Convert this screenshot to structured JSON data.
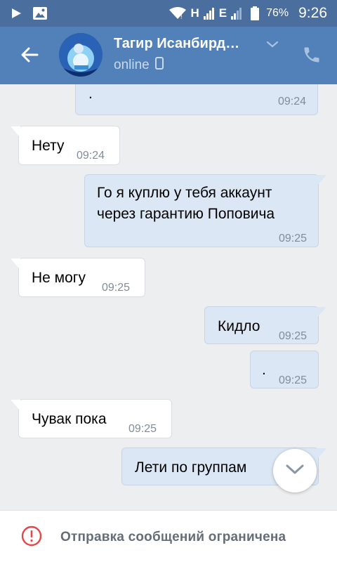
{
  "status_bar": {
    "network_label_1": "H",
    "network_label_2": "E",
    "battery_percent": "76%",
    "time": "9:26",
    "icons": [
      "play-icon",
      "image-icon",
      "wifi-icon",
      "signal-icon",
      "battery-icon"
    ]
  },
  "header": {
    "contact_name": "Тагир Исанбирд…",
    "status": "online",
    "icons": [
      "back-arrow-icon",
      "chevron-down-icon",
      "phone-mobile-icon",
      "phone-icon"
    ]
  },
  "messages": [
    {
      "direction": "out",
      "text": ".",
      "time": "09:24"
    },
    {
      "direction": "in",
      "text": "Нету",
      "time": "09:24"
    },
    {
      "direction": "out",
      "text": "Го я куплю у тебя аккаунт через гарантию Поповича",
      "time": "09:25"
    },
    {
      "direction": "in",
      "text": "Не могу",
      "time": "09:25"
    },
    {
      "direction": "out",
      "text": "Кидло",
      "time": "09:25"
    },
    {
      "direction": "out",
      "text": ".",
      "time": "09:25"
    },
    {
      "direction": "in",
      "text": "Чувак пока",
      "time": "09:25"
    },
    {
      "direction": "out",
      "text": "Лети по группам",
      "time": ""
    }
  ],
  "footer": {
    "restriction_text": "Отправка сообщений ограничена",
    "icon": "alert-circle-icon"
  },
  "colors": {
    "header_bg": "#5181b8",
    "status_bar_bg": "#4a6f9f",
    "chat_bg": "#edeef0",
    "outgoing_bubble": "#dbe7f5",
    "incoming_bubble": "#ffffff",
    "alert_red": "#e64646"
  }
}
